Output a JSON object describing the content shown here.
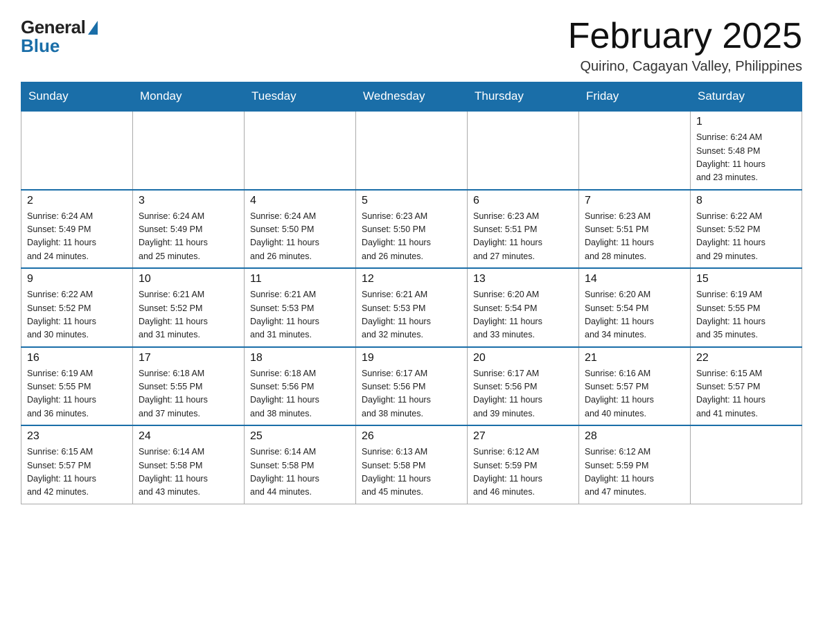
{
  "logo": {
    "general": "General",
    "blue": "Blue"
  },
  "title": "February 2025",
  "subtitle": "Quirino, Cagayan Valley, Philippines",
  "days_header": [
    "Sunday",
    "Monday",
    "Tuesday",
    "Wednesday",
    "Thursday",
    "Friday",
    "Saturday"
  ],
  "weeks": [
    [
      {
        "day": "",
        "info": ""
      },
      {
        "day": "",
        "info": ""
      },
      {
        "day": "",
        "info": ""
      },
      {
        "day": "",
        "info": ""
      },
      {
        "day": "",
        "info": ""
      },
      {
        "day": "",
        "info": ""
      },
      {
        "day": "1",
        "info": "Sunrise: 6:24 AM\nSunset: 5:48 PM\nDaylight: 11 hours\nand 23 minutes."
      }
    ],
    [
      {
        "day": "2",
        "info": "Sunrise: 6:24 AM\nSunset: 5:49 PM\nDaylight: 11 hours\nand 24 minutes."
      },
      {
        "day": "3",
        "info": "Sunrise: 6:24 AM\nSunset: 5:49 PM\nDaylight: 11 hours\nand 25 minutes."
      },
      {
        "day": "4",
        "info": "Sunrise: 6:24 AM\nSunset: 5:50 PM\nDaylight: 11 hours\nand 26 minutes."
      },
      {
        "day": "5",
        "info": "Sunrise: 6:23 AM\nSunset: 5:50 PM\nDaylight: 11 hours\nand 26 minutes."
      },
      {
        "day": "6",
        "info": "Sunrise: 6:23 AM\nSunset: 5:51 PM\nDaylight: 11 hours\nand 27 minutes."
      },
      {
        "day": "7",
        "info": "Sunrise: 6:23 AM\nSunset: 5:51 PM\nDaylight: 11 hours\nand 28 minutes."
      },
      {
        "day": "8",
        "info": "Sunrise: 6:22 AM\nSunset: 5:52 PM\nDaylight: 11 hours\nand 29 minutes."
      }
    ],
    [
      {
        "day": "9",
        "info": "Sunrise: 6:22 AM\nSunset: 5:52 PM\nDaylight: 11 hours\nand 30 minutes."
      },
      {
        "day": "10",
        "info": "Sunrise: 6:21 AM\nSunset: 5:52 PM\nDaylight: 11 hours\nand 31 minutes."
      },
      {
        "day": "11",
        "info": "Sunrise: 6:21 AM\nSunset: 5:53 PM\nDaylight: 11 hours\nand 31 minutes."
      },
      {
        "day": "12",
        "info": "Sunrise: 6:21 AM\nSunset: 5:53 PM\nDaylight: 11 hours\nand 32 minutes."
      },
      {
        "day": "13",
        "info": "Sunrise: 6:20 AM\nSunset: 5:54 PM\nDaylight: 11 hours\nand 33 minutes."
      },
      {
        "day": "14",
        "info": "Sunrise: 6:20 AM\nSunset: 5:54 PM\nDaylight: 11 hours\nand 34 minutes."
      },
      {
        "day": "15",
        "info": "Sunrise: 6:19 AM\nSunset: 5:55 PM\nDaylight: 11 hours\nand 35 minutes."
      }
    ],
    [
      {
        "day": "16",
        "info": "Sunrise: 6:19 AM\nSunset: 5:55 PM\nDaylight: 11 hours\nand 36 minutes."
      },
      {
        "day": "17",
        "info": "Sunrise: 6:18 AM\nSunset: 5:55 PM\nDaylight: 11 hours\nand 37 minutes."
      },
      {
        "day": "18",
        "info": "Sunrise: 6:18 AM\nSunset: 5:56 PM\nDaylight: 11 hours\nand 38 minutes."
      },
      {
        "day": "19",
        "info": "Sunrise: 6:17 AM\nSunset: 5:56 PM\nDaylight: 11 hours\nand 38 minutes."
      },
      {
        "day": "20",
        "info": "Sunrise: 6:17 AM\nSunset: 5:56 PM\nDaylight: 11 hours\nand 39 minutes."
      },
      {
        "day": "21",
        "info": "Sunrise: 6:16 AM\nSunset: 5:57 PM\nDaylight: 11 hours\nand 40 minutes."
      },
      {
        "day": "22",
        "info": "Sunrise: 6:15 AM\nSunset: 5:57 PM\nDaylight: 11 hours\nand 41 minutes."
      }
    ],
    [
      {
        "day": "23",
        "info": "Sunrise: 6:15 AM\nSunset: 5:57 PM\nDaylight: 11 hours\nand 42 minutes."
      },
      {
        "day": "24",
        "info": "Sunrise: 6:14 AM\nSunset: 5:58 PM\nDaylight: 11 hours\nand 43 minutes."
      },
      {
        "day": "25",
        "info": "Sunrise: 6:14 AM\nSunset: 5:58 PM\nDaylight: 11 hours\nand 44 minutes."
      },
      {
        "day": "26",
        "info": "Sunrise: 6:13 AM\nSunset: 5:58 PM\nDaylight: 11 hours\nand 45 minutes."
      },
      {
        "day": "27",
        "info": "Sunrise: 6:12 AM\nSunset: 5:59 PM\nDaylight: 11 hours\nand 46 minutes."
      },
      {
        "day": "28",
        "info": "Sunrise: 6:12 AM\nSunset: 5:59 PM\nDaylight: 11 hours\nand 47 minutes."
      },
      {
        "day": "",
        "info": ""
      }
    ]
  ]
}
